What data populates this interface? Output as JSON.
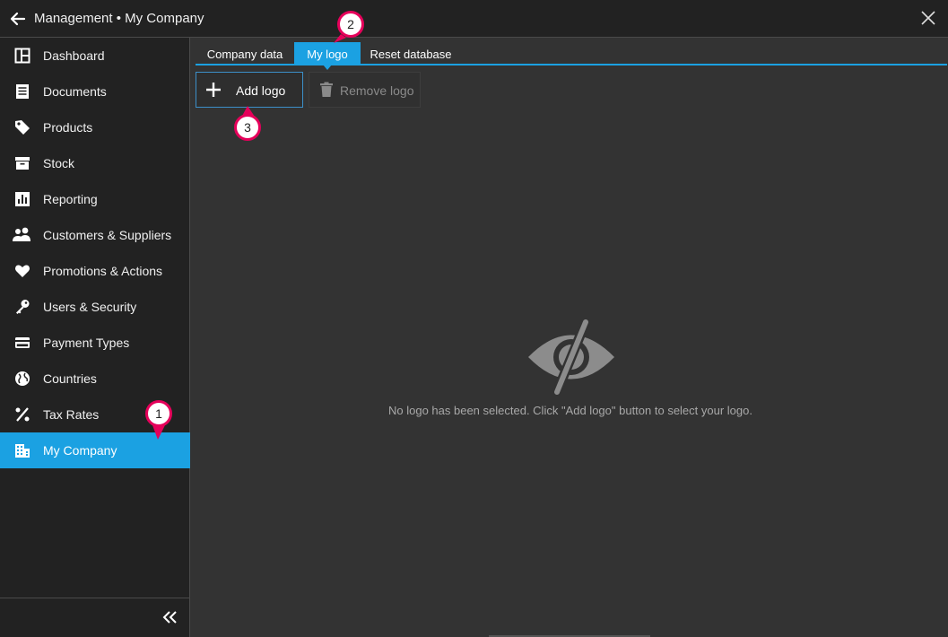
{
  "window": {
    "title": "Management • My Company",
    "back_icon": "arrow-left-icon",
    "close_icon": "close-icon"
  },
  "sidebar": {
    "items": [
      {
        "label": "Dashboard",
        "icon": "dashboard-icon"
      },
      {
        "label": "Documents",
        "icon": "documents-icon"
      },
      {
        "label": "Products",
        "icon": "tag-icon"
      },
      {
        "label": "Stock",
        "icon": "archive-box-icon"
      },
      {
        "label": "Reporting",
        "icon": "bar-chart-icon"
      },
      {
        "label": "Customers & Suppliers",
        "icon": "users-icon"
      },
      {
        "label": "Promotions & Actions",
        "icon": "heart-icon"
      },
      {
        "label": "Users & Security",
        "icon": "key-icon"
      },
      {
        "label": "Payment Types",
        "icon": "credit-card-icon"
      },
      {
        "label": "Countries",
        "icon": "globe-icon"
      },
      {
        "label": "Tax Rates",
        "icon": "percent-icon"
      },
      {
        "label": "My Company",
        "icon": "building-icon",
        "active": true
      }
    ],
    "collapse_icon": "double-chevron-left-icon"
  },
  "tabs": [
    {
      "label": "Company data"
    },
    {
      "label": "My logo",
      "active": true
    },
    {
      "label": "Reset database"
    }
  ],
  "toolbar": {
    "add_logo_label": "Add logo",
    "remove_logo_label": "Remove logo"
  },
  "empty_state": {
    "icon": "eye-slash-icon",
    "message": "No logo has been selected. Click \"Add logo\" button to select your logo."
  },
  "callouts": [
    "1",
    "2",
    "3"
  ],
  "colors": {
    "accent": "#1ba1e2",
    "callout": "#e5005a",
    "sidebar_bg": "#222222",
    "content_bg": "#333333"
  }
}
